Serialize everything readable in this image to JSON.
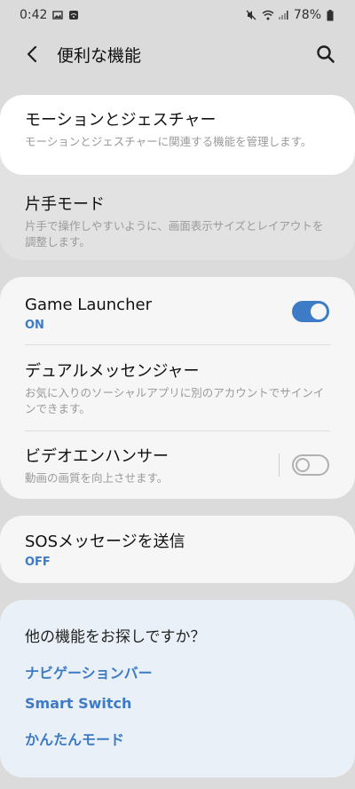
{
  "status": {
    "time": "0:42",
    "battery": "78%"
  },
  "header": {
    "title": "便利な機能"
  },
  "items": {
    "motion": {
      "title": "モーションとジェスチャー",
      "desc": "モーションとジェスチャーに関連する機能を管理します。"
    },
    "one_hand": {
      "title": "片手モード",
      "desc": "片手で操作しやすいように、画面表示サイズとレイアウトを調整します。"
    },
    "game_launcher": {
      "title": "Game Launcher",
      "status": "ON",
      "enabled": true
    },
    "dual_messenger": {
      "title": "デュアルメッセンジャー",
      "desc": "お気に入りのソーシャルアプリに別のアカウントでサインインできます。"
    },
    "video_enhancer": {
      "title": "ビデオエンハンサー",
      "desc": "動画の画質を向上させます。",
      "enabled": false
    },
    "sos": {
      "title": "SOSメッセージを送信",
      "status": "OFF"
    }
  },
  "more": {
    "heading": "他の機能をお探しですか？",
    "links": [
      "ナビゲーションバー",
      "Smart Switch",
      "かんたんモード"
    ]
  },
  "colors": {
    "accent": "#3d7bc7",
    "background": "#eeeeee",
    "card": "#f6f6f6"
  }
}
